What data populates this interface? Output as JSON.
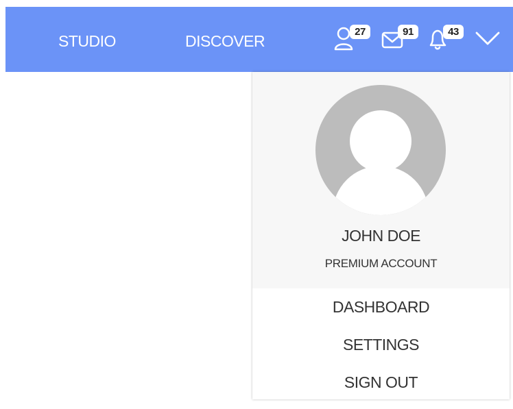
{
  "header": {
    "nav": [
      {
        "label": "STUDIO"
      },
      {
        "label": "DISCOVER"
      }
    ],
    "notifications": {
      "users": {
        "icon": "user-icon",
        "count": "27"
      },
      "mail": {
        "icon": "mail-icon",
        "count": "91"
      },
      "alerts": {
        "icon": "bell-icon",
        "count": "43"
      }
    },
    "menu_toggle_icon": "chevron-down-icon",
    "accent_color": "#6b93f7"
  },
  "profile": {
    "avatar_icon": "avatar-placeholder",
    "name": "JOHN DOE",
    "account_type": "PREMIUM ACCOUNT"
  },
  "menu": {
    "items": [
      {
        "label": "DASHBOARD"
      },
      {
        "label": "SETTINGS"
      },
      {
        "label": "SIGN OUT"
      }
    ]
  }
}
